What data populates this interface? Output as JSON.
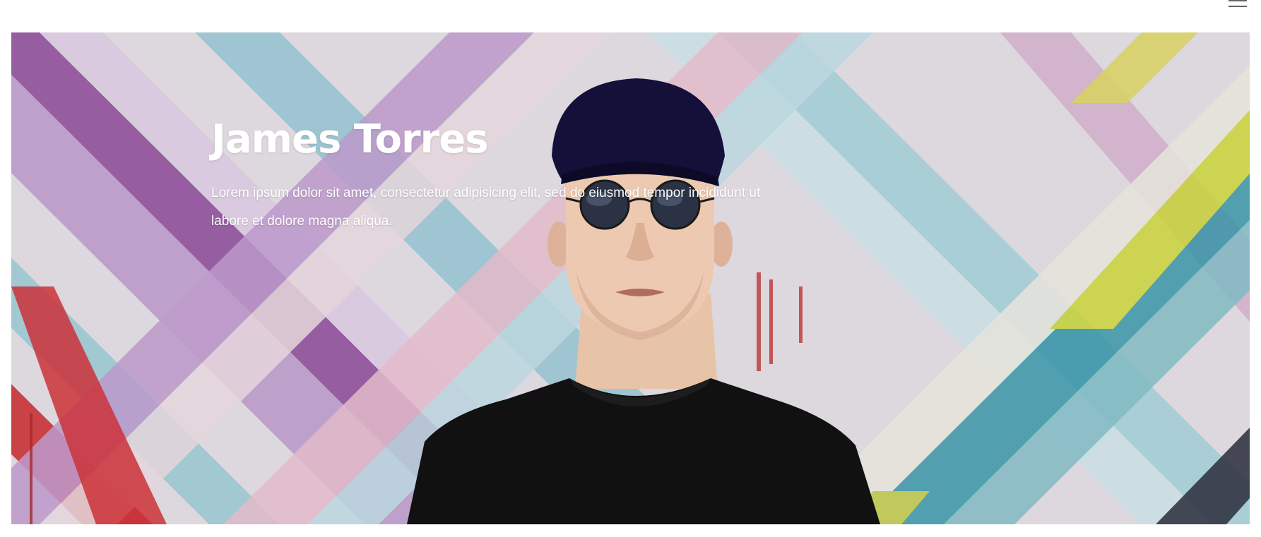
{
  "header": {
    "menu_icon": "hamburger-menu-icon"
  },
  "hero": {
    "title": "James Torres",
    "description": "Lorem ipsum dolor sit amet, consectetur adipisicing elit, sed do eiusmod tempor incididunt ut labore et dolore magna aliqua.",
    "image": "person-portrait-graffiti-wall"
  },
  "colors": {
    "page_background": "#ffffff",
    "hero_text": "#ffffff",
    "menu_icon": "#666666",
    "shirt": "#111111",
    "cap": "#14103a"
  }
}
